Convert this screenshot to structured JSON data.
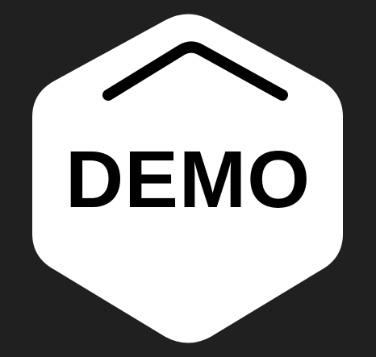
{
  "background_color": "#202020",
  "badge_color": "#ffffff",
  "mark_color": "#000000",
  "logo_text": "DEMO",
  "icons": [
    "hexagon-badge-icon",
    "roof-chevron-icon"
  ]
}
